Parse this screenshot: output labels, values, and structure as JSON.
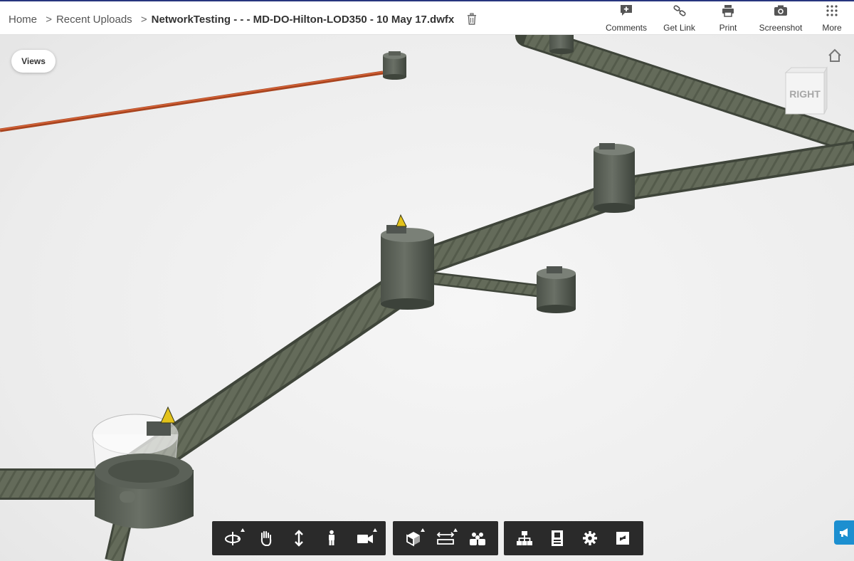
{
  "breadcrumb": {
    "home": "Home",
    "separator": ">",
    "recent": "Recent Uploads",
    "file": "NetworkTesting - - - MD-DO-Hilton-LOD350 - 10 May 17.dwfx"
  },
  "actions": [
    {
      "label": "Comments",
      "icon": "comment-plus-icon"
    },
    {
      "label": "Get Link",
      "icon": "link-icon"
    },
    {
      "label": "Print",
      "icon": "printer-icon"
    },
    {
      "label": "Screenshot",
      "icon": "camera-icon"
    },
    {
      "label": "More",
      "icon": "grid-dots-icon"
    }
  ],
  "viewer": {
    "views_button": "Views",
    "viewcube_face": "RIGHT"
  },
  "toolbar_groups": [
    [
      "orbit-icon",
      "pan-icon",
      "zoom-icon",
      "first-person-icon",
      "camera-icon"
    ],
    [
      "section-icon",
      "measure-icon",
      "explode-icon"
    ],
    [
      "model-browser-icon",
      "properties-icon",
      "settings-icon",
      "fullscreen-icon"
    ]
  ],
  "colors": {
    "accent": "#27357e",
    "toolbar_bg": "#2a2a2a",
    "pipe": "#5e6655",
    "pipe_orange": "#c0522a",
    "feedback_tab": "#1c8fd0"
  }
}
